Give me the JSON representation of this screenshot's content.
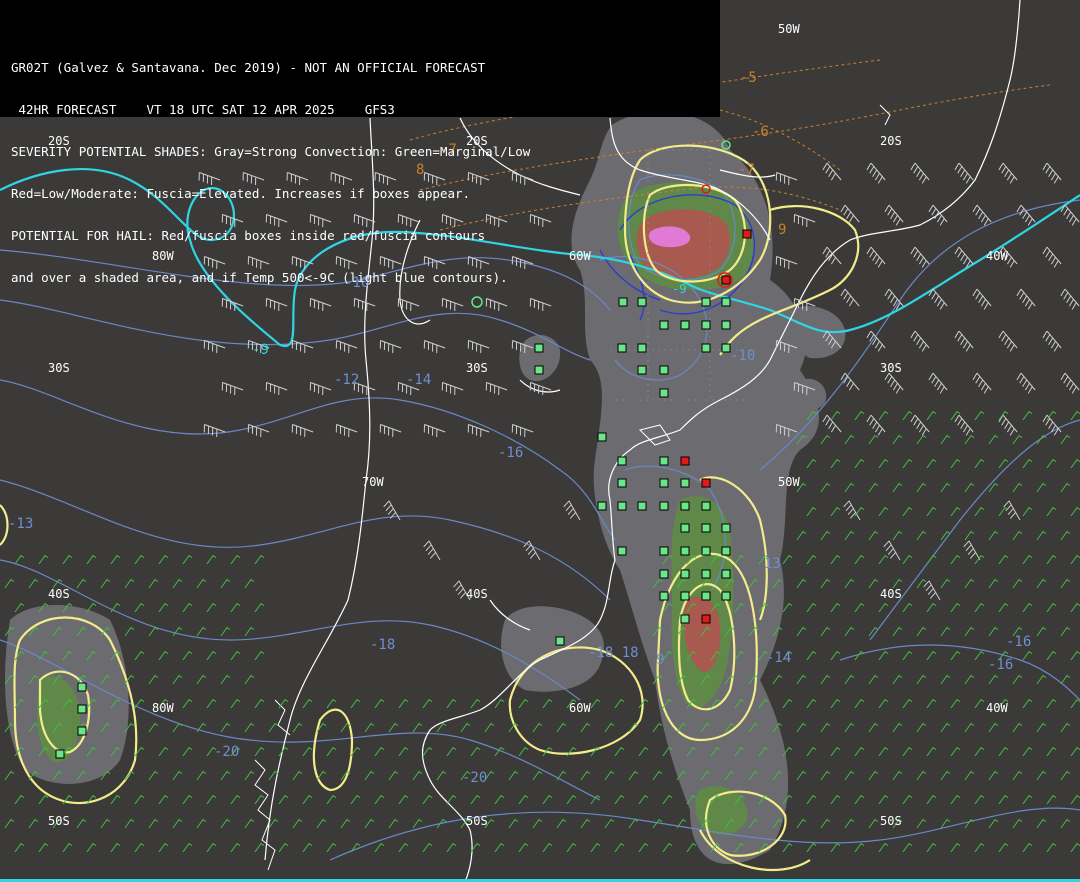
{
  "header": {
    "line1": "GR02T (Galvez & Santavana. Dec 2019) - NOT AN OFFICIAL FORECAST",
    "line2": " 42HR FORECAST    VT 18 UTC SAT 12 APR 2025    GFS3",
    "line3": "SEVERITY POTENTIAL SHADES: Gray=Strong Convection: Green=Marginal/Low",
    "line4": "Red=Low/Moderate: Fuscia=Elevated. Increases if boxes appear.",
    "line5": "POTENTIAL FOR HAIL: Red/fuscia boxes inside red/fuscia contours",
    "line6": "and over a shaded area, and if Temp 500<-9C (light blue contours)."
  },
  "grid_labels": {
    "lon_50w_top": "50W",
    "lat_20s_left": "20S",
    "lat_20s_mid": "20S",
    "lat_20s_right": "20S",
    "lon_80w_a": "80W",
    "lon_60w_a": "60W",
    "lon_40w_a": "40W",
    "lat_30s_left": "30S",
    "lat_30s_mid": "30S",
    "lat_30s_right": "30S",
    "lon_70w": "70W",
    "lon_50w_mid": "50W",
    "lat_40s_left": "40S",
    "lat_40s_mid": "40S",
    "lat_40s_right": "40S",
    "lon_80w_b": "80W",
    "lon_60w_b": "60W",
    "lon_40w_b": "40W",
    "lat_50s_left": "50S",
    "lat_50s_mid": "50S",
    "lat_50s_right": "50S"
  },
  "contour_labels": {
    "orange_m5": "-5",
    "orange_m6": "-6",
    "orange_m7a": "-7",
    "orange_m7b": "-7",
    "orange_8": "8",
    "orange_9": "9",
    "cyan_m9": "-9",
    "cyan_m9b": "-9",
    "blue_m10": "-10",
    "blue_m10b": "-10",
    "blue_m12": "-12",
    "blue_m14": "-14",
    "blue_m16": "-16",
    "blue_m13a": "-13",
    "blue_m13b": "13",
    "blue_m18a": "-18",
    "blue_m18b": "-18 18",
    "blue_m14b": "-14",
    "blue_m16b": "-16",
    "blue_m16c": "-16",
    "blue_m20a": "-20",
    "blue_m20b": "-20",
    "blue_m9c": "9"
  },
  "colors": {
    "background": "#3b3a39",
    "coastline": "#ffffff",
    "cyan_contour": "#2fd5e3",
    "blue_contour": "#6f8fcf",
    "orange_contour": "#c8812c",
    "yellow_contour": "#f2ec8c",
    "gray_shade": "#77767a",
    "green_shade": "#5f8f4a",
    "red_shade": "#a9584f",
    "fuscia_shade": "#e27ad4",
    "box_green": "#6be58a",
    "box_red": "#e01919",
    "barb_white": "#cfcfcf",
    "barb_green": "#3fbf3f"
  }
}
